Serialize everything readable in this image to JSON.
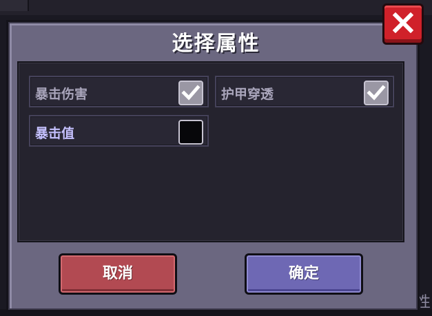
{
  "dialog": {
    "title": "选择属性",
    "cancel_label": "取消",
    "confirm_label": "确定"
  },
  "options": [
    {
      "label": "暴击伤害",
      "checked": true
    },
    {
      "label": "护甲穿透",
      "checked": true
    },
    {
      "label": "暴击值",
      "checked": false
    }
  ],
  "background": {
    "side_char": "性"
  },
  "colors": {
    "cancel": "#b24a52",
    "confirm": "#6e68b4",
    "close": "#d0212a",
    "panel": "#25232e",
    "dialog_frame": "#6b6780"
  },
  "icons": {
    "close": "close-x-icon",
    "check": "checkmark-icon"
  }
}
